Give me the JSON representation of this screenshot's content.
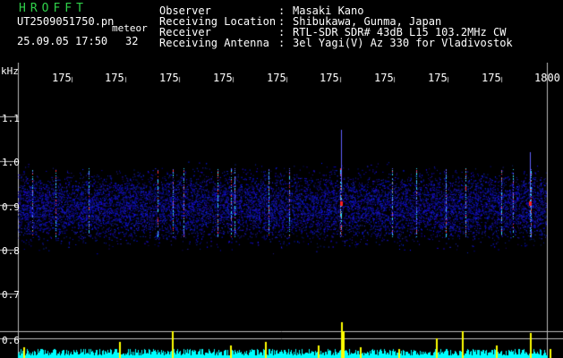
{
  "header": {
    "app_title": "HROFFT",
    "file_name": "UT2509051750.pn",
    "app_name": "meteor",
    "date_time": "25.09.05 17:50",
    "count": "32"
  },
  "info": [
    {
      "label": "Observer",
      "value": "Masaki Kano"
    },
    {
      "label": "Receiving Location",
      "value": "Shibukawa, Gunma, Japan"
    },
    {
      "label": "Receiver",
      "value": "RTL-SDR SDR# 43dB L15 103.2MHz CW"
    },
    {
      "label": "Receiving Antenna",
      "value": "3el Yagi(V) Az 330 for Vladivostok"
    }
  ],
  "axis": {
    "unit": "kHz",
    "freq_ticks": [
      "175",
      "175",
      "175",
      "175",
      "175",
      "175",
      "175",
      "175",
      "175",
      "1800"
    ],
    "power_ticks": [
      "1.1",
      "1.0",
      "0.9",
      "0.8",
      "0.7",
      "0.6"
    ]
  },
  "colors": {
    "title": "#2fd14a",
    "grid": "#bbbbbb",
    "noise": "#1a1acc",
    "echo": "#ffff00",
    "noise_floor": "#00ffff"
  }
}
